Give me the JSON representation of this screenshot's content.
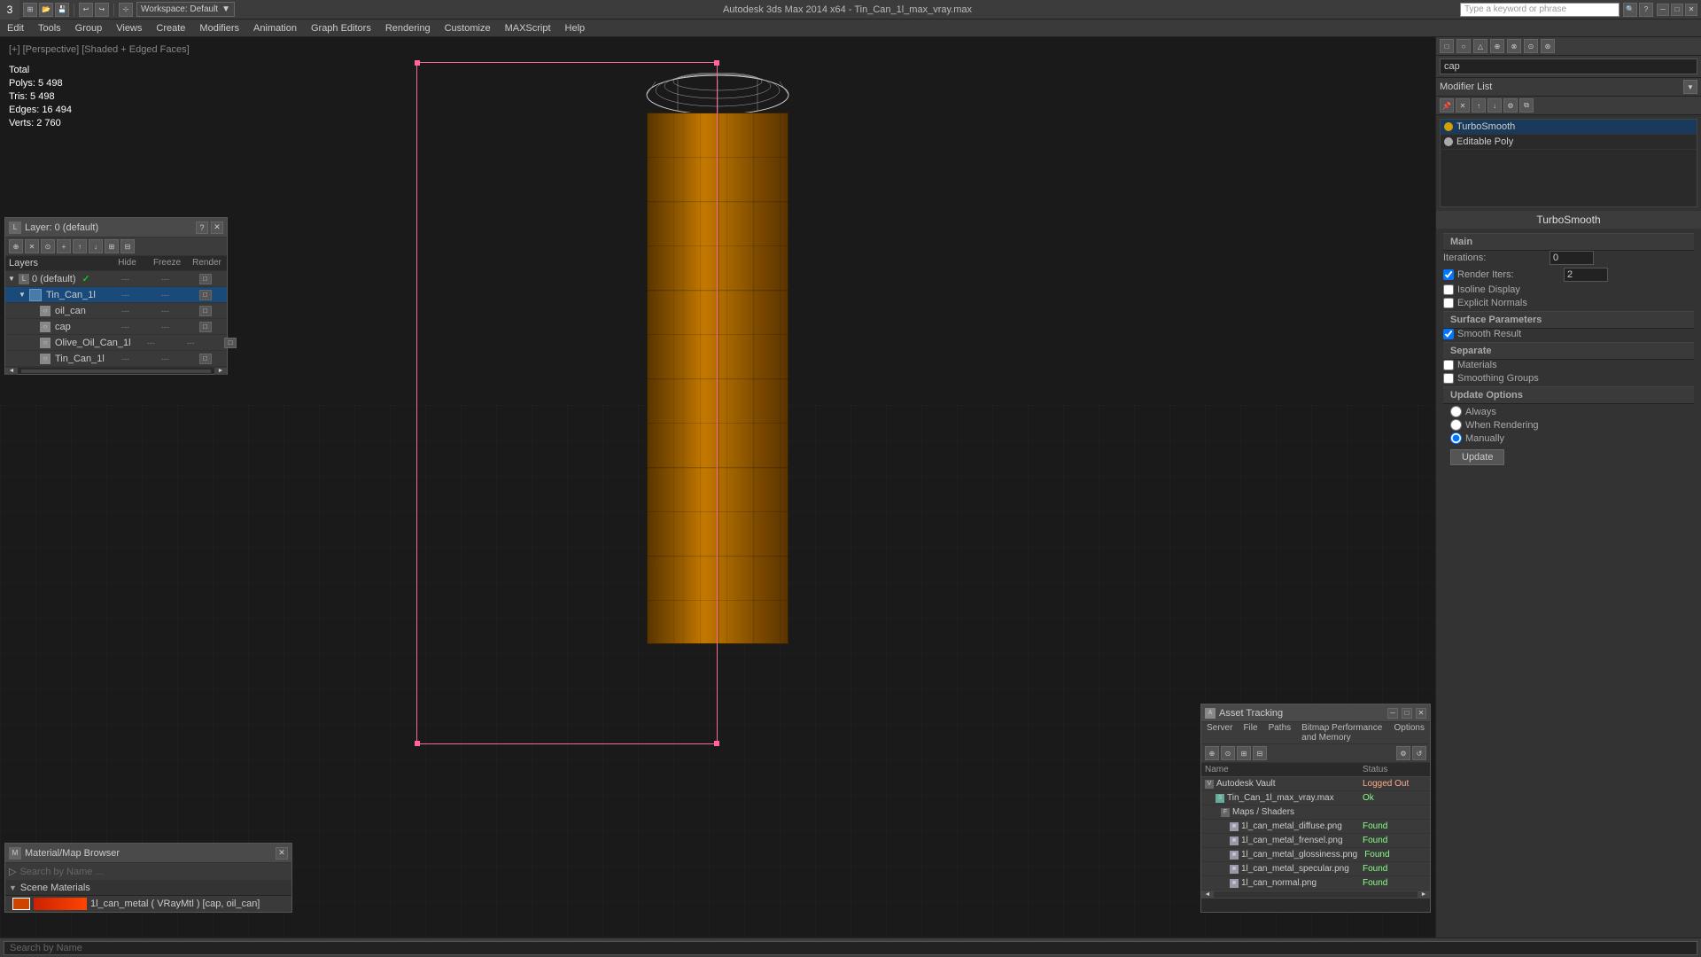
{
  "app": {
    "title": "Autodesk 3ds Max 2014 x64  -  Tin_Can_1l_max_vray.max",
    "workspace": "Workspace: Default"
  },
  "topbar": {
    "search_placeholder": "Type a keyword or phrase"
  },
  "menubar": {
    "items": [
      "Edit",
      "Tools",
      "Group",
      "Views",
      "Create",
      "Modifiers",
      "Animation",
      "Graph Editors",
      "Rendering",
      "Customize",
      "MAXScript",
      "Help"
    ]
  },
  "viewport": {
    "label": "[+] [Perspective] [Shaded + Edged Faces]",
    "stats": {
      "polys_label": "Polys:",
      "polys_value": "5 498",
      "tris_label": "Tris:",
      "tris_value": "5 498",
      "edges_label": "Edges:",
      "edges_value": "16 494",
      "verts_label": "Verts:",
      "verts_value": "2 760",
      "total_label": "Total"
    }
  },
  "layers_panel": {
    "title": "Layer: 0 (default)",
    "columns": {
      "hide": "Hide",
      "freeze": "Freeze",
      "render": "Render"
    },
    "rows": [
      {
        "id": "default",
        "name": "0 (default)",
        "level": 0,
        "expanded": true,
        "active": false
      },
      {
        "id": "tin_can_1l",
        "name": "Tin_Can_1l",
        "level": 1,
        "expanded": true,
        "active": true
      },
      {
        "id": "oil_can",
        "name": "oil_can",
        "level": 2,
        "expanded": false,
        "active": false
      },
      {
        "id": "cap",
        "name": "cap",
        "level": 2,
        "expanded": false,
        "active": false
      },
      {
        "id": "olive_oil_can_1l",
        "name": "Olive_Oil_Can_1l",
        "level": 2,
        "expanded": false,
        "active": false
      },
      {
        "id": "tin_can_1l_2",
        "name": "Tin_Can_1l",
        "level": 2,
        "expanded": false,
        "active": false
      }
    ]
  },
  "right_panel": {
    "object_name": "cap",
    "modifier_list_label": "Modifier List",
    "modifiers": [
      {
        "name": "TurboSmooth",
        "type": "turbosmooth"
      },
      {
        "name": "Editable Poly",
        "type": "editable_poly"
      }
    ],
    "turbosmooth": {
      "title": "TurboSmooth",
      "main_label": "Main",
      "iterations_label": "Iterations:",
      "iterations_value": "0",
      "render_iters_label": "Render Iters:",
      "render_iters_value": "2",
      "isoline_display": "Isoline Display",
      "explicit_normals": "Explicit Normals",
      "surface_params_label": "Surface Parameters",
      "smooth_result": "Smooth Result",
      "separate_label": "Separate",
      "materials_label": "Materials",
      "smoothing_groups": "Smoothing Groups",
      "update_options_label": "Update Options",
      "always": "Always",
      "when_rendering": "When Rendering",
      "manually": "Manually",
      "update_button": "Update"
    }
  },
  "mat_browser": {
    "title": "Material/Map Browser",
    "search_placeholder": "Search by Name ...",
    "scene_materials": "Scene Materials",
    "materials": [
      {
        "name": "1l_can_metal ( VRayMtl ) [cap, oil_can]"
      }
    ]
  },
  "asset_tracking": {
    "title": "Asset Tracking",
    "menu": [
      "Server",
      "File",
      "Paths",
      "Bitmap Performance and Memory",
      "Options"
    ],
    "columns": {
      "name": "Name",
      "status": "Status"
    },
    "rows": [
      {
        "indent": 0,
        "name": "Autodesk Vault",
        "status": "Logged Out",
        "status_type": "logout"
      },
      {
        "indent": 1,
        "name": "Tin_Can_1l_max_vray.max",
        "status": "Ok",
        "status_type": "ok"
      },
      {
        "indent": 1,
        "name": "Maps / Shaders",
        "status": "",
        "status_type": ""
      },
      {
        "indent": 2,
        "name": "1l_can_metal_diffuse.png",
        "status": "Found",
        "status_type": "ok"
      },
      {
        "indent": 2,
        "name": "1l_can_metal_frensel.png",
        "status": "Found",
        "status_type": "ok"
      },
      {
        "indent": 2,
        "name": "1l_can_metal_glossiness.png",
        "status": "Found",
        "status_type": "ok"
      },
      {
        "indent": 2,
        "name": "1l_can_metal_specular.png",
        "status": "Found",
        "status_type": "ok"
      },
      {
        "indent": 2,
        "name": "1l_can_normal.png",
        "status": "Found",
        "status_type": "ok"
      }
    ]
  },
  "status_bar": {
    "search_placeholder": "Search by Name"
  },
  "icons": {
    "expand": "▶",
    "collapse": "▼",
    "close": "✕",
    "help": "?",
    "minimize": "─",
    "maximize": "□",
    "check": "✓",
    "arrow_left": "◄",
    "arrow_right": "►"
  }
}
